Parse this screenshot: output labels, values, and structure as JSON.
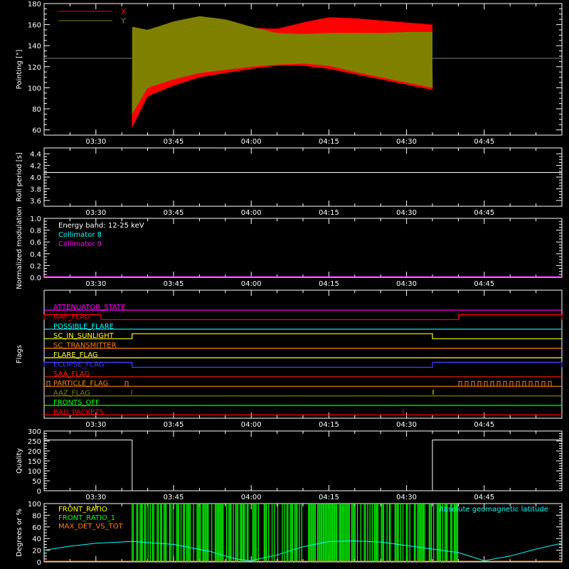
{
  "colors": {
    "background": "#000000",
    "axes": "#ffffff",
    "x_series": "#ff0000",
    "y_series": "#808000",
    "roll": "#ffffff",
    "collimator_8": "#00ffff",
    "collimator_9": "#ff00ff",
    "front_ratio": "#ffff00",
    "front_ratio_alt": "#00ff00",
    "max_det_vs_tot": "#ff8000",
    "geomag": "#00ffff",
    "quality": "#ffffff"
  },
  "chart_data": [
    {
      "id": "pointing",
      "type": "area",
      "ylabel": "Pointing [\"]",
      "ylim": [
        55,
        180
      ],
      "yticks": [
        60,
        80,
        100,
        120,
        140,
        160,
        180
      ],
      "xlim_minutes": [
        3.3333,
        4.9667
      ],
      "xtick_labels": [
        "03:30",
        "03:45",
        "04:00",
        "04:15",
        "04:30",
        "04:45"
      ],
      "legend": [
        "X",
        "Y"
      ],
      "legend_position": "top-left",
      "reference_line": 128,
      "series": [
        {
          "name": "X",
          "start": "03:37",
          "end": "04:35",
          "envelope": {
            "t": [
              "03:37",
              "03:40",
              "03:45",
              "03:50",
              "03:55",
              "04:00",
              "04:05",
              "04:10",
              "04:15",
              "04:20",
              "04:25",
              "04:30",
              "04:35"
            ],
            "low": [
              62,
              92,
              102,
              110,
              114,
              118,
              121,
              121,
              118,
              113,
              108,
              103,
              98
            ],
            "high": [
              155,
              150,
              162,
              167,
              163,
              157,
              156,
              162,
              167,
              166,
              164,
              162,
              160
            ]
          }
        },
        {
          "name": "Y",
          "start": "03:37",
          "end": "04:35",
          "envelope": {
            "t": [
              "03:37",
              "03:40",
              "03:45",
              "03:50",
              "03:55",
              "04:00",
              "04:05",
              "04:10",
              "04:15",
              "04:20",
              "04:25",
              "04:30",
              "04:35"
            ],
            "low": [
              75,
              100,
              108,
              114,
              117,
              120,
              122,
              123,
              121,
              115,
              110,
              105,
              100
            ],
            "high": [
              158,
              155,
              163,
              168,
              165,
              158,
              152,
              151,
              152,
              152,
              152,
              153,
              153
            ]
          }
        }
      ]
    },
    {
      "id": "roll",
      "type": "line",
      "ylabel": "Roll period [s]",
      "ylim": [
        3.5,
        4.5
      ],
      "yticks": [
        3.6,
        3.8,
        4.0,
        4.2,
        4.4
      ],
      "xtick_labels": [
        "03:30",
        "03:45",
        "04:00",
        "04:15",
        "04:30",
        "04:45"
      ],
      "series": [
        {
          "values": [
            4.08
          ]
        }
      ]
    },
    {
      "id": "modulation",
      "type": "line",
      "ylabel": "Normalized modulation",
      "ylim": [
        0,
        1
      ],
      "yticks": [
        0.0,
        0.2,
        0.4,
        0.6,
        0.8,
        1.0
      ],
      "xtick_labels": [
        "03:30",
        "03:45",
        "04:00",
        "04:15",
        "04:30",
        "04:45"
      ],
      "legend": [
        "Energy band: 12-25 keV",
        "Collimator 8",
        "Collimator 9"
      ],
      "series": [
        {
          "name": "Collimator 9",
          "values": [
            0.0
          ]
        }
      ]
    },
    {
      "id": "flags",
      "type": "line",
      "ylabel": "Flags",
      "xtick_labels": [
        "03:30",
        "03:45",
        "04:00",
        "04:15",
        "04:30",
        "04:45"
      ],
      "flags": [
        {
          "name": "ATTENUATOR_STATE",
          "color": "#ff00ff"
        },
        {
          "name": "GAP_FLAG",
          "color": "#ff0000",
          "on": [
            [
              "03:20",
              "03:31"
            ],
            [
              "04:40",
              "05:00"
            ]
          ]
        },
        {
          "name": "POSSIBLE_FLARE",
          "color": "#00ffff"
        },
        {
          "name": "SC_IN_SUNLIGHT",
          "color": "#ffff00",
          "on": [
            [
              "03:37",
              "04:35"
            ]
          ]
        },
        {
          "name": "SC_TRANSMITTER",
          "color": "#ff8000"
        },
        {
          "name": "FLARE_FLAG",
          "color": "#ffff40"
        },
        {
          "name": "ECLIPSE_FLAG",
          "color": "#4040ff",
          "on": [
            [
              "03:20",
              "03:37"
            ],
            [
              "04:35",
              "05:00"
            ]
          ]
        },
        {
          "name": "SAA_FLAG",
          "color": "#ff2000"
        },
        {
          "name": "PARTICLE_FLAG",
          "color": "#ff8000"
        },
        {
          "name": "AAZ_FLAG",
          "color": "#808000"
        },
        {
          "name": "FRONTS_OFF",
          "color": "#00ff00"
        },
        {
          "name": "BAD_PACKETS",
          "color": "#ff0000"
        }
      ]
    },
    {
      "id": "quality",
      "type": "line",
      "ylabel": "Quality",
      "ylim": [
        0,
        300
      ],
      "yticks": [
        0,
        50,
        100,
        150,
        200,
        250,
        300
      ],
      "xtick_labels": [
        "03:30",
        "03:45",
        "04:00",
        "04:15",
        "04:30",
        "04:45"
      ],
      "series": [
        {
          "t": [
            "03:20",
            "03:37",
            "03:37",
            "04:35",
            "04:35",
            "05:00"
          ],
          "values": [
            255,
            255,
            0,
            0,
            255,
            255
          ]
        }
      ]
    },
    {
      "id": "ratios",
      "type": "bar",
      "ylabel": "Degrees or %",
      "ylim": [
        0,
        100
      ],
      "yticks": [
        0,
        20,
        40,
        60,
        80,
        100
      ],
      "legend": [
        "FRONT_RATIO",
        "FRONT_RATIO_1",
        "MAX_DET_VS_TOT"
      ],
      "geomag_label": "Absolute geomagnetic latitude",
      "green_span": [
        "03:37",
        "04:40"
      ],
      "geomag": {
        "t": [
          "03:20",
          "03:25",
          "03:30",
          "03:37",
          "03:45",
          "03:52",
          "03:57",
          "04:00",
          "04:05",
          "04:10",
          "04:15",
          "04:20",
          "04:25",
          "04:30",
          "04:35",
          "04:40",
          "04:45",
          "04:50",
          "04:55",
          "05:00"
        ],
        "values": [
          20,
          27,
          32,
          35,
          30,
          18,
          5,
          2,
          12,
          26,
          35,
          36,
          34,
          28,
          22,
          16,
          2,
          10,
          22,
          32
        ]
      }
    }
  ]
}
